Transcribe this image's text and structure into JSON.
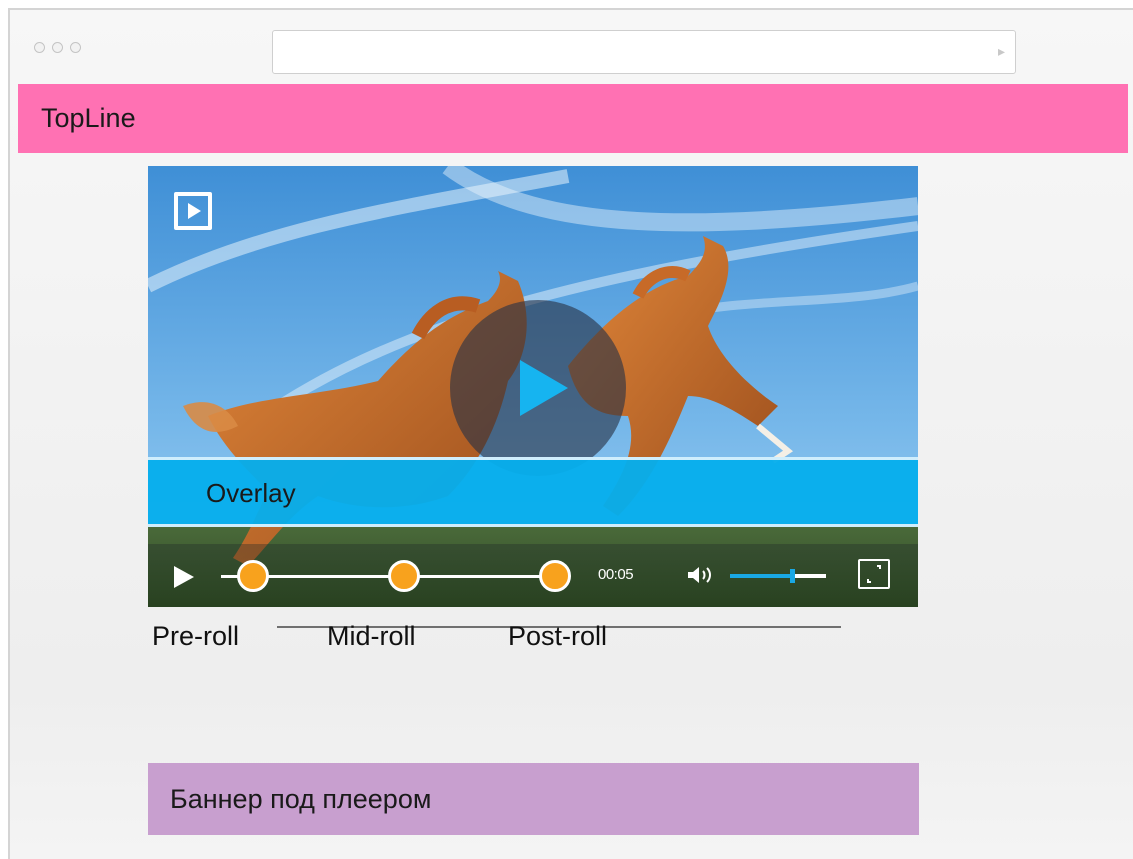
{
  "browser": {
    "url": ""
  },
  "topline": {
    "label": "TopLine",
    "color": "#ff71b3"
  },
  "player": {
    "poster_description_icon": "horses-scene",
    "logo_icon": "play-logo-icon",
    "big_play_icon": "play-icon",
    "overlay_label": "Overlay",
    "overlay_color": "#06aeec",
    "time": "00:05",
    "volume_level": 0.65,
    "markers": [
      "pre-roll",
      "mid-roll",
      "post-roll"
    ],
    "marker_color": "#f8a21d"
  },
  "ad_positions": {
    "pre_roll": "Pre-roll",
    "mid_roll": "Mid-roll",
    "post_roll": "Post-roll"
  },
  "banner": {
    "label": "Баннер под плеером",
    "color": "#c89fcf"
  }
}
